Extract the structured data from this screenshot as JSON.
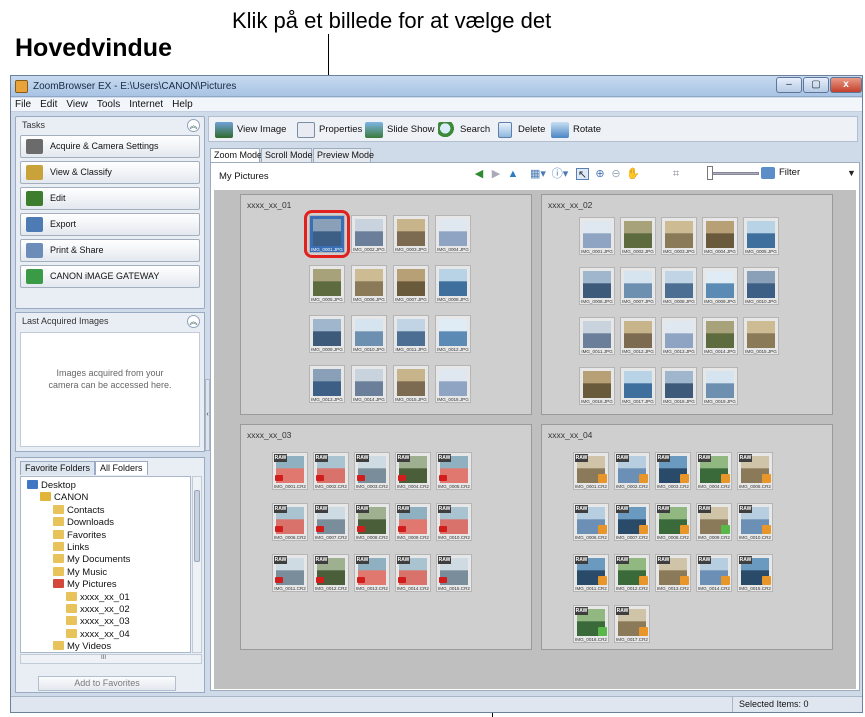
{
  "annotations": {
    "top_caption": "Klik på et billede for at vælge det",
    "section_title": "Hovedvindue"
  },
  "window": {
    "title": "ZoomBrowser EX  -  E:\\Users\\CANON\\Pictures",
    "controls": [
      "–",
      "▢",
      "x"
    ]
  },
  "menu": [
    "File",
    "Edit",
    "View",
    "Tools",
    "Internet",
    "Help"
  ],
  "tasks": {
    "header": "Tasks",
    "items": [
      {
        "label": "Acquire & Camera Settings",
        "color": "#6b6b6b"
      },
      {
        "label": "View & Classify",
        "color": "#c9a23a"
      },
      {
        "label": "Edit",
        "color": "#3d7e2e"
      },
      {
        "label": "Export",
        "color": "#4f7bb4"
      },
      {
        "label": "Print & Share",
        "color": "#6c8db8"
      },
      {
        "label": "CANON iMAGE GATEWAY",
        "color": "#3a9a46"
      }
    ]
  },
  "last_acquired": {
    "header": "Last Acquired Images",
    "message_line1": "Images acquired from your",
    "message_line2": "camera can be accessed here."
  },
  "folders": {
    "tabs": [
      "Favorite Folders",
      "All Folders"
    ],
    "active_tab": "All Folders",
    "tree": [
      "Desktop",
      "CANON",
      "Contacts",
      "Downloads",
      "Favorites",
      "Links",
      "My Documents",
      "My Music",
      "My Pictures",
      "xxxx_xx_01",
      "xxxx_xx_02",
      "xxxx_xx_03",
      "xxxx_xx_04",
      "My Videos"
    ],
    "add_button": "Add to Favorites",
    "scroll_label": "III"
  },
  "toolbar": [
    "View Image",
    "Properties",
    "Slide Show",
    "Search",
    "Delete",
    "Rotate"
  ],
  "view_tabs": [
    "Zoom Mode",
    "Scroll Mode",
    "Preview Mode"
  ],
  "active_view_tab": "Zoom Mode",
  "browser": {
    "breadcrumb": "My Pictures",
    "filter_label": "Filter",
    "nav_icons": [
      "back-icon",
      "forward-icon",
      "up-icon",
      "zoom-select-icon",
      "info-icon",
      "pointer-icon",
      "zoom-in-icon",
      "zoom-out-icon",
      "hand-icon",
      "fit-icon"
    ]
  },
  "groups": [
    {
      "name": "xxxx_xx_01",
      "images": [
        "IMG_0001.JPG",
        "IMG_0002.JPG",
        "IMG_0003.JPG",
        "IMG_0004.JPG",
        "IMG_0005.JPG",
        "IMG_0006.JPG",
        "IMG_0007.JPG",
        "IMG_0008.JPG",
        "IMG_0009.JPG",
        "IMG_0010.JPG",
        "IMG_0011.JPG",
        "IMG_0012.JPG",
        "IMG_0013.JPG",
        "IMG_0014.JPG",
        "IMG_0015.JPG",
        "IMG_0016.JPG"
      ],
      "selected_index": 0
    },
    {
      "name": "xxxx_xx_02",
      "images": [
        "IMG_0001.JPG",
        "IMG_0002.JPG",
        "IMG_0003.JPG",
        "IMG_0004.JPG",
        "IMG_0005.JPG",
        "IMG_0006.JPG",
        "IMG_0007.JPG",
        "IMG_0008.JPG",
        "IMG_0009.JPG",
        "IMG_0010.JPG",
        "IMG_0011.JPG",
        "IMG_0012.JPG",
        "IMG_0013.JPG",
        "IMG_0014.JPG",
        "IMG_0015.JPG",
        "IMG_0016.JPG",
        "IMG_0017.JPG",
        "IMG_0018.JPG",
        "IMG_0019.JPG"
      ]
    },
    {
      "name": "xxxx_xx_03",
      "images": [
        "IMG_0001.CR2",
        "IMG_0002.CR2",
        "IMG_0003.CR2",
        "IMG_0004.CR2",
        "IMG_0005.CR2",
        "IMG_0006.CR2",
        "IMG_0007.CR2",
        "IMG_0008.CR2",
        "IMG_0009.CR2",
        "IMG_0010.CR2",
        "IMG_0011.CR2",
        "IMG_0012.CR2",
        "IMG_0013.CR2",
        "IMG_0014.CR2",
        "IMG_0015.CR2"
      ],
      "raw_label": "RAW"
    },
    {
      "name": "xxxx_xx_04",
      "images": [
        "IMG_0001.CR2",
        "IMG_0002.CR2",
        "IMG_0003.CR2",
        "IMG_0004.CR2",
        "IMG_0005.CR2",
        "IMG_0006.CR2",
        "IMG_0007.CR2",
        "IMG_0008.CR2",
        "IMG_0009.CR2",
        "IMG_0010.CR2",
        "IMG_0011.CR2",
        "IMG_0012.CR2",
        "IMG_0013.CR2",
        "IMG_0014.CR2",
        "IMG_0015.CR2",
        "IMG_0016.CR2",
        "IMG_0017.CR2"
      ],
      "raw_label": "RAW"
    }
  ],
  "status": {
    "selected_items": "Selected Items: 0"
  },
  "colors": {
    "selection_ring": "#e0211d",
    "group_bg": "#cfcfcf",
    "canvas_bg": "#bfbfbf"
  }
}
